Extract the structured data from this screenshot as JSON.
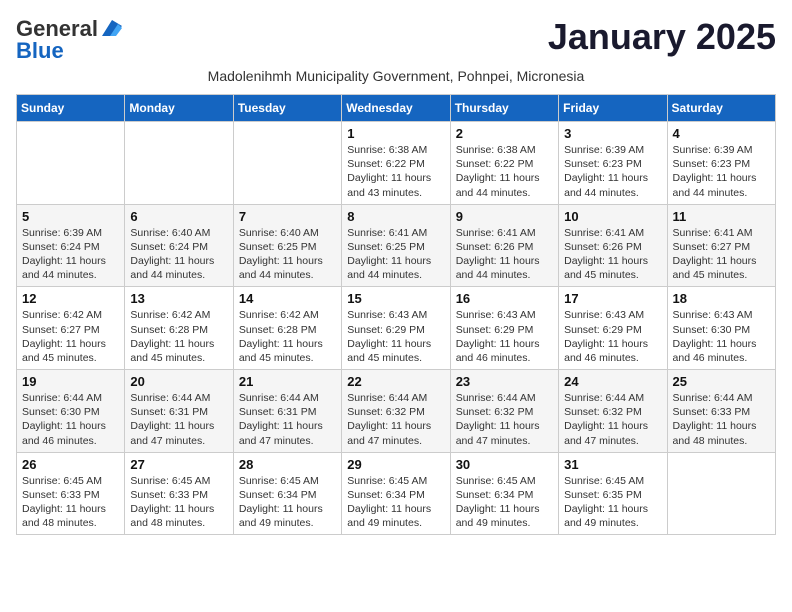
{
  "header": {
    "logo_general": "General",
    "logo_blue": "Blue",
    "month_title": "January 2025",
    "subtitle": "Madolenihmh Municipality Government, Pohnpei, Micronesia"
  },
  "weekdays": [
    "Sunday",
    "Monday",
    "Tuesday",
    "Wednesday",
    "Thursday",
    "Friday",
    "Saturday"
  ],
  "weeks": [
    [
      {
        "day": "",
        "info": ""
      },
      {
        "day": "",
        "info": ""
      },
      {
        "day": "",
        "info": ""
      },
      {
        "day": "1",
        "info": "Sunrise: 6:38 AM\nSunset: 6:22 PM\nDaylight: 11 hours and 43 minutes."
      },
      {
        "day": "2",
        "info": "Sunrise: 6:38 AM\nSunset: 6:22 PM\nDaylight: 11 hours and 44 minutes."
      },
      {
        "day": "3",
        "info": "Sunrise: 6:39 AM\nSunset: 6:23 PM\nDaylight: 11 hours and 44 minutes."
      },
      {
        "day": "4",
        "info": "Sunrise: 6:39 AM\nSunset: 6:23 PM\nDaylight: 11 hours and 44 minutes."
      }
    ],
    [
      {
        "day": "5",
        "info": "Sunrise: 6:39 AM\nSunset: 6:24 PM\nDaylight: 11 hours and 44 minutes."
      },
      {
        "day": "6",
        "info": "Sunrise: 6:40 AM\nSunset: 6:24 PM\nDaylight: 11 hours and 44 minutes."
      },
      {
        "day": "7",
        "info": "Sunrise: 6:40 AM\nSunset: 6:25 PM\nDaylight: 11 hours and 44 minutes."
      },
      {
        "day": "8",
        "info": "Sunrise: 6:41 AM\nSunset: 6:25 PM\nDaylight: 11 hours and 44 minutes."
      },
      {
        "day": "9",
        "info": "Sunrise: 6:41 AM\nSunset: 6:26 PM\nDaylight: 11 hours and 44 minutes."
      },
      {
        "day": "10",
        "info": "Sunrise: 6:41 AM\nSunset: 6:26 PM\nDaylight: 11 hours and 45 minutes."
      },
      {
        "day": "11",
        "info": "Sunrise: 6:41 AM\nSunset: 6:27 PM\nDaylight: 11 hours and 45 minutes."
      }
    ],
    [
      {
        "day": "12",
        "info": "Sunrise: 6:42 AM\nSunset: 6:27 PM\nDaylight: 11 hours and 45 minutes."
      },
      {
        "day": "13",
        "info": "Sunrise: 6:42 AM\nSunset: 6:28 PM\nDaylight: 11 hours and 45 minutes."
      },
      {
        "day": "14",
        "info": "Sunrise: 6:42 AM\nSunset: 6:28 PM\nDaylight: 11 hours and 45 minutes."
      },
      {
        "day": "15",
        "info": "Sunrise: 6:43 AM\nSunset: 6:29 PM\nDaylight: 11 hours and 45 minutes."
      },
      {
        "day": "16",
        "info": "Sunrise: 6:43 AM\nSunset: 6:29 PM\nDaylight: 11 hours and 46 minutes."
      },
      {
        "day": "17",
        "info": "Sunrise: 6:43 AM\nSunset: 6:29 PM\nDaylight: 11 hours and 46 minutes."
      },
      {
        "day": "18",
        "info": "Sunrise: 6:43 AM\nSunset: 6:30 PM\nDaylight: 11 hours and 46 minutes."
      }
    ],
    [
      {
        "day": "19",
        "info": "Sunrise: 6:44 AM\nSunset: 6:30 PM\nDaylight: 11 hours and 46 minutes."
      },
      {
        "day": "20",
        "info": "Sunrise: 6:44 AM\nSunset: 6:31 PM\nDaylight: 11 hours and 47 minutes."
      },
      {
        "day": "21",
        "info": "Sunrise: 6:44 AM\nSunset: 6:31 PM\nDaylight: 11 hours and 47 minutes."
      },
      {
        "day": "22",
        "info": "Sunrise: 6:44 AM\nSunset: 6:32 PM\nDaylight: 11 hours and 47 minutes."
      },
      {
        "day": "23",
        "info": "Sunrise: 6:44 AM\nSunset: 6:32 PM\nDaylight: 11 hours and 47 minutes."
      },
      {
        "day": "24",
        "info": "Sunrise: 6:44 AM\nSunset: 6:32 PM\nDaylight: 11 hours and 47 minutes."
      },
      {
        "day": "25",
        "info": "Sunrise: 6:44 AM\nSunset: 6:33 PM\nDaylight: 11 hours and 48 minutes."
      }
    ],
    [
      {
        "day": "26",
        "info": "Sunrise: 6:45 AM\nSunset: 6:33 PM\nDaylight: 11 hours and 48 minutes."
      },
      {
        "day": "27",
        "info": "Sunrise: 6:45 AM\nSunset: 6:33 PM\nDaylight: 11 hours and 48 minutes."
      },
      {
        "day": "28",
        "info": "Sunrise: 6:45 AM\nSunset: 6:34 PM\nDaylight: 11 hours and 49 minutes."
      },
      {
        "day": "29",
        "info": "Sunrise: 6:45 AM\nSunset: 6:34 PM\nDaylight: 11 hours and 49 minutes."
      },
      {
        "day": "30",
        "info": "Sunrise: 6:45 AM\nSunset: 6:34 PM\nDaylight: 11 hours and 49 minutes."
      },
      {
        "day": "31",
        "info": "Sunrise: 6:45 AM\nSunset: 6:35 PM\nDaylight: 11 hours and 49 minutes."
      },
      {
        "day": "",
        "info": ""
      }
    ]
  ]
}
